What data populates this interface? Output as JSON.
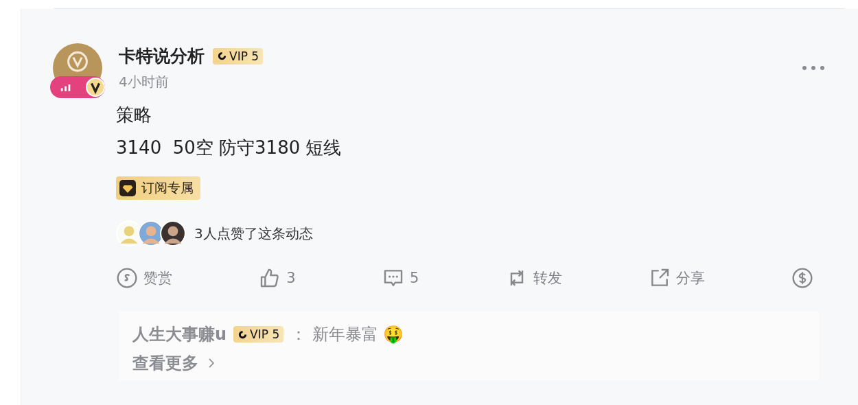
{
  "post": {
    "author": "卡特说分析",
    "vip": "VIP 5",
    "time": "4小时前",
    "lines": [
      "策略",
      "3140  50空 防守3180 短线"
    ],
    "tag": "订阅专属",
    "likers_text": "3人点赞了这条动态",
    "actions": [
      {
        "kind": "reward",
        "label": "赞赏"
      },
      {
        "kind": "like",
        "label": "3"
      },
      {
        "kind": "comment",
        "label": "5"
      },
      {
        "kind": "repost",
        "label": "转发"
      },
      {
        "kind": "share",
        "label": "分享"
      },
      {
        "kind": "tip"
      }
    ],
    "comments": [
      {
        "user": "人生大事赚u",
        "vip": "VIP 5",
        "sep": "：",
        "text": "新年暴富 🤑"
      }
    ],
    "more": "查看更多"
  }
}
